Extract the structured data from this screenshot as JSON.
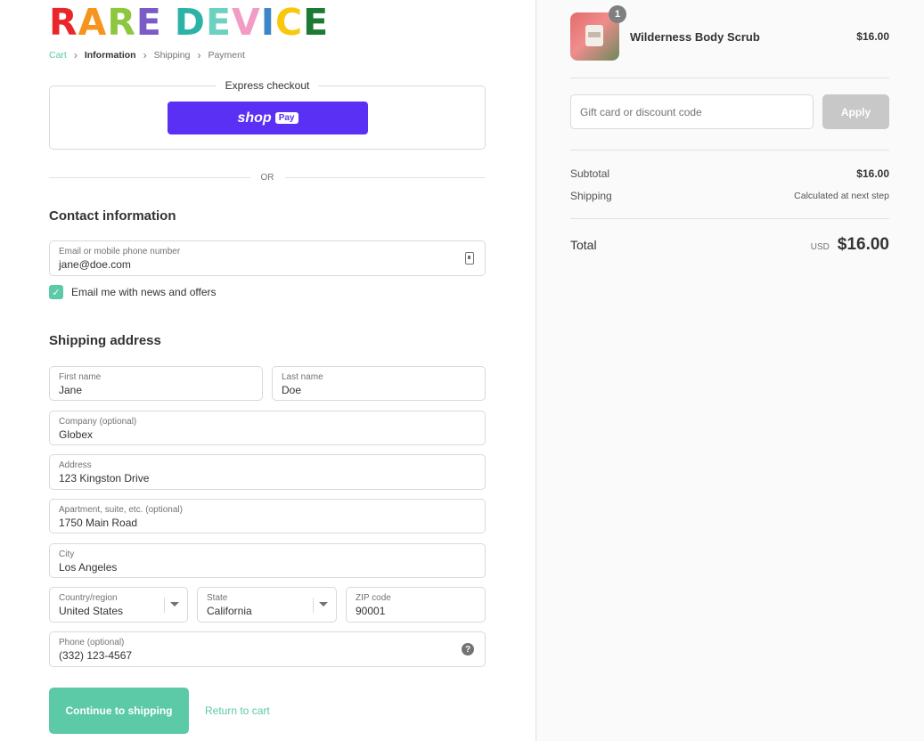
{
  "brand": {
    "logo_letters": [
      {
        "ch": "R",
        "color": "#e8262b"
      },
      {
        "ch": "A",
        "color": "#f7941d"
      },
      {
        "ch": "R",
        "color": "#8dc63f"
      },
      {
        "ch": "E",
        "color": "#7b5cc6"
      },
      {
        "ch": " ",
        "color": "#ffffff"
      },
      {
        "ch": "D",
        "color": "#2ab3a6"
      },
      {
        "ch": "E",
        "color": "#6dd1c2"
      },
      {
        "ch": "V",
        "color": "#f29bc4"
      },
      {
        "ch": "I",
        "color": "#3b86c9"
      },
      {
        "ch": "C",
        "color": "#f9c80e"
      },
      {
        "ch": "E",
        "color": "#1d7a34"
      }
    ],
    "accent": "#5cc9a7",
    "shop_pay_color": "#5a31f4"
  },
  "breadcrumb": {
    "cart": "Cart",
    "information": "Information",
    "shipping": "Shipping",
    "payment": "Payment"
  },
  "express": {
    "title": "Express checkout",
    "shop_word": "shop",
    "pay_word": "Pay"
  },
  "or_text": "OR",
  "contact": {
    "title": "Contact information",
    "email_label": "Email or mobile phone number",
    "email_value": "jane@doe.com",
    "newsletter_label": "Email me with news and offers",
    "newsletter_checked": true
  },
  "shipping": {
    "title": "Shipping address",
    "first_name_label": "First name",
    "first_name": "Jane",
    "last_name_label": "Last name",
    "last_name": "Doe",
    "company_label": "Company (optional)",
    "company": "Globex",
    "address_label": "Address",
    "address": "123 Kingston Drive",
    "apartment_label": "Apartment, suite, etc. (optional)",
    "apartment": "1750 Main Road",
    "city_label": "City",
    "city": "Los Angeles",
    "country_label": "Country/region",
    "country": "United States",
    "state_label": "State",
    "state": "California",
    "zip_label": "ZIP code",
    "zip": "90001",
    "phone_label": "Phone (optional)",
    "phone": "(332) 123-4567"
  },
  "actions": {
    "continue": "Continue to shipping",
    "return": "Return to cart"
  },
  "summary": {
    "product_name": "Wilderness Body Scrub",
    "product_qty": "1",
    "product_price": "$16.00",
    "discount_placeholder": "Gift card or discount code",
    "apply": "Apply",
    "subtotal_label": "Subtotal",
    "subtotal_value": "$16.00",
    "shipping_label": "Shipping",
    "shipping_value": "Calculated at next step",
    "total_label": "Total",
    "currency": "USD",
    "total_value": "$16.00"
  }
}
